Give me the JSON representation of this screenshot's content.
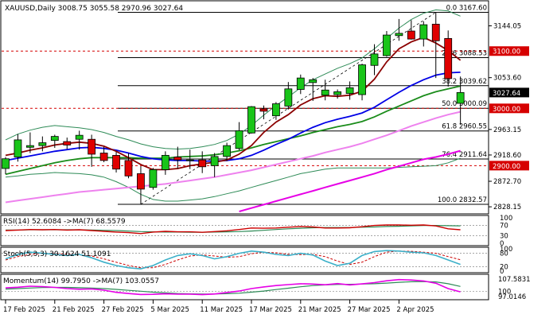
{
  "chart_data": {
    "type": "candlestick",
    "symbol_line": "XAUUSD,Daily  3008.75 3055.58 2970.96 3027.64",
    "price_axis": {
      "ylim": [
        2820,
        3185
      ],
      "ticks": [
        "3144.05",
        "3053.60",
        "2963.15",
        "2918.60",
        "2872.70",
        "2828.15"
      ],
      "tick_values": [
        3144.05,
        3053.6,
        2963.15,
        2918.6,
        2872.7,
        2828.15
      ]
    },
    "dates": [
      "17 Feb 2025",
      "21 Feb 2025",
      "27 Feb 2025",
      "5 Mar 2025",
      "11 Mar 2025",
      "17 Mar 2025",
      "21 Mar 2025",
      "27 Mar 2025",
      "2 Apr 2025"
    ],
    "date_index": [
      0,
      4,
      8,
      12,
      16,
      20,
      24,
      28,
      32
    ],
    "candles": [
      {
        "o": 2895,
        "h": 2915,
        "l": 2885,
        "c": 2912
      },
      {
        "o": 2915,
        "h": 2955,
        "l": 2907,
        "c": 2945
      },
      {
        "o": 2932,
        "h": 2958,
        "l": 2922,
        "c": 2935
      },
      {
        "o": 2935,
        "h": 2951,
        "l": 2925,
        "c": 2940
      },
      {
        "o": 2944,
        "h": 2954,
        "l": 2931,
        "c": 2951
      },
      {
        "o": 2942,
        "h": 2949,
        "l": 2929,
        "c": 2936
      },
      {
        "o": 2946,
        "h": 2961,
        "l": 2928,
        "c": 2953
      },
      {
        "o": 2946,
        "h": 2954,
        "l": 2898,
        "c": 2920
      },
      {
        "o": 2922,
        "h": 2933,
        "l": 2906,
        "c": 2909
      },
      {
        "o": 2918,
        "h": 2924,
        "l": 2888,
        "c": 2894
      },
      {
        "o": 2909,
        "h": 2922,
        "l": 2878,
        "c": 2882
      },
      {
        "o": 2886,
        "h": 2899,
        "l": 2832,
        "c": 2859
      },
      {
        "o": 2862,
        "h": 2896,
        "l": 2858,
        "c": 2893
      },
      {
        "o": 2893,
        "h": 2925,
        "l": 2884,
        "c": 2918
      },
      {
        "o": 2915,
        "h": 2933,
        "l": 2895,
        "c": 2910
      },
      {
        "o": 2909,
        "h": 2928,
        "l": 2894,
        "c": 2910
      },
      {
        "o": 2910,
        "h": 2925,
        "l": 2887,
        "c": 2898
      },
      {
        "o": 2900,
        "h": 2922,
        "l": 2880,
        "c": 2916
      },
      {
        "o": 2916,
        "h": 2940,
        "l": 2908,
        "c": 2935
      },
      {
        "o": 2930,
        "h": 2976,
        "l": 2927,
        "c": 2961
      },
      {
        "o": 2957,
        "h": 3004,
        "l": 2956,
        "c": 3003
      },
      {
        "o": 2999,
        "h": 3005,
        "l": 2981,
        "c": 2995
      },
      {
        "o": 2987,
        "h": 3011,
        "l": 2980,
        "c": 3008
      },
      {
        "o": 3004,
        "h": 3046,
        "l": 2998,
        "c": 3034
      },
      {
        "o": 3033,
        "h": 3059,
        "l": 3025,
        "c": 3053
      },
      {
        "o": 3045,
        "h": 3053,
        "l": 3013,
        "c": 3050
      },
      {
        "o": 3023,
        "h": 3050,
        "l": 3014,
        "c": 3032
      },
      {
        "o": 3024,
        "h": 3033,
        "l": 3017,
        "c": 3029
      },
      {
        "o": 3026,
        "h": 3047,
        "l": 3015,
        "c": 3036
      },
      {
        "o": 3024,
        "h": 3078,
        "l": 3014,
        "c": 3076
      },
      {
        "o": 3075,
        "h": 3112,
        "l": 3058,
        "c": 3095
      },
      {
        "o": 3092,
        "h": 3135,
        "l": 3090,
        "c": 3128
      },
      {
        "o": 3127,
        "h": 3156,
        "l": 3118,
        "c": 3131
      },
      {
        "o": 3135,
        "h": 3154,
        "l": 3120,
        "c": 3121
      },
      {
        "o": 3121,
        "h": 3152,
        "l": 3108,
        "c": 3146
      },
      {
        "o": 3147,
        "h": 3167,
        "l": 3053,
        "c": 3118
      },
      {
        "o": 3122,
        "h": 3136,
        "l": 3038,
        "c": 3052
      },
      {
        "o": 3008.75,
        "h": 3055.58,
        "l": 2970.96,
        "c": 3027.64
      }
    ],
    "overlays": {
      "ma_red": [
        2918,
        2922,
        2927,
        2931,
        2936,
        2939,
        2941,
        2939,
        2934,
        2925,
        2914,
        2902,
        2893,
        2893,
        2895,
        2900,
        2903,
        2906,
        2910,
        2920,
        2935,
        2958,
        2976,
        2989,
        3006,
        3017,
        3022,
        3021,
        3023,
        3030,
        3051,
        3081,
        3104,
        3116,
        3124,
        3114,
        3101,
        3084
      ],
      "ma_blue": [
        2909,
        2913,
        2917,
        2921,
        2925,
        2928,
        2931,
        2932,
        2930,
        2927,
        2922,
        2916,
        2912,
        2910,
        2909,
        2909,
        2908,
        2908,
        2909,
        2912,
        2918,
        2927,
        2937,
        2946,
        2957,
        2967,
        2975,
        2981,
        2986,
        2992,
        3002,
        3015,
        3028,
        3040,
        3050,
        3058,
        3062,
        3063
      ],
      "ma_green": [
        2885,
        2890,
        2895,
        2900,
        2905,
        2909,
        2912,
        2914,
        2914,
        2914,
        2914,
        2913,
        2913,
        2913,
        2915,
        2916,
        2917,
        2919,
        2922,
        2926,
        2931,
        2937,
        2942,
        2947,
        2952,
        2958,
        2963,
        2968,
        2972,
        2977,
        2985,
        2995,
        3004,
        3013,
        3022,
        3029,
        3034,
        3039
      ],
      "ma_pink": [
        2836,
        2839,
        2842,
        2845,
        2848,
        2851,
        2854,
        2856,
        2858,
        2860,
        2862,
        2864,
        2866,
        2868,
        2871,
        2874,
        2877,
        2880,
        2884,
        2888,
        2892,
        2897,
        2902,
        2907,
        2912,
        2917,
        2923,
        2928,
        2933,
        2939,
        2946,
        2953,
        2961,
        2969,
        2976,
        2983,
        2989,
        2994
      ],
      "ma_magenta_start_index": 19,
      "ma_magenta": [
        2820,
        2826,
        2832,
        2838,
        2844,
        2850,
        2856,
        2862,
        2868,
        2874,
        2880,
        2886,
        2893,
        2899,
        2905,
        2911,
        2915,
        2920,
        2926
      ],
      "bb_upper": [
        2945,
        2955,
        2962,
        2967,
        2970,
        2968,
        2966,
        2963,
        2958,
        2951,
        2945,
        2938,
        2933,
        2930,
        2929,
        2930,
        2933,
        2937,
        2944,
        2955,
        2970,
        2988,
        3005,
        3020,
        3036,
        3050,
        3060,
        3070,
        3078,
        3088,
        3104,
        3122,
        3140,
        3155,
        3166,
        3172,
        3170,
        3161
      ],
      "bb_lower": [
        2880,
        2882,
        2885,
        2886,
        2888,
        2887,
        2886,
        2884,
        2880,
        2872,
        2862,
        2850,
        2841,
        2838,
        2838,
        2840,
        2842,
        2846,
        2851,
        2856,
        2862,
        2868,
        2874,
        2880,
        2886,
        2890,
        2894,
        2896,
        2896,
        2896,
        2896,
        2896,
        2897,
        2898,
        2899,
        2900,
        2905,
        2913
      ],
      "fib_line": {
        "from_index": 11,
        "from_price": 2832.57,
        "to_index": 35,
        "to_price": 3167.6
      }
    },
    "horizontal_levels": [
      {
        "label": "0.0 3167.60",
        "value": 3167.6,
        "style": "fib"
      },
      {
        "label": "23.6 3088.53",
        "value": 3088.53,
        "style": "fib"
      },
      {
        "label": "38.2 3039.62",
        "value": 3039.62,
        "style": "fib"
      },
      {
        "label": "50.0 3000.09",
        "value": 3000.09,
        "style": "fib"
      },
      {
        "label": "61.8 2960.55",
        "value": 2960.55,
        "style": "fib"
      },
      {
        "label": "76.4 2911.64",
        "value": 2911.64,
        "style": "fib"
      },
      {
        "label": "100.0 2832.57",
        "value": 2832.57,
        "style": "fib"
      },
      {
        "label": "",
        "value": 3100,
        "style": "red-dashed"
      },
      {
        "label": "",
        "value": 3000,
        "style": "red-dashed"
      },
      {
        "label": "",
        "value": 2900,
        "style": "red-dashed"
      }
    ],
    "price_tags": [
      {
        "text": "3100.00",
        "value": 3100,
        "bg": "#d60000",
        "fg": "#ffffff"
      },
      {
        "text": "3027.64",
        "value": 3027.64,
        "bg": "#000000",
        "fg": "#ffffff"
      },
      {
        "text": "3000.00",
        "value": 3000,
        "bg": "#d60000",
        "fg": "#ffffff"
      },
      {
        "text": "2900.00",
        "value": 2900,
        "bg": "#d60000",
        "fg": "#ffffff"
      }
    ],
    "rsi_panel": {
      "label": "RSI(14) 52.6084  ->MA(7) 68.5579",
      "ylim": [
        0,
        100
      ],
      "ticks": [
        "100",
        "70",
        "30",
        "0"
      ],
      "tick_values": [
        100,
        70,
        30,
        0
      ],
      "rsi": [
        50,
        52,
        54,
        53,
        54,
        52,
        53,
        50,
        47,
        44,
        42,
        38,
        44,
        47,
        45,
        45,
        43,
        46,
        49,
        54,
        60,
        59,
        60,
        63,
        66,
        64,
        60,
        60,
        61,
        65,
        70,
        72,
        72,
        71,
        72,
        68,
        57,
        53
      ],
      "ma": [
        52,
        52,
        53,
        53,
        53,
        53,
        53,
        52,
        51,
        50,
        48,
        46,
        45,
        44,
        44,
        43,
        43,
        44,
        45,
        46,
        48,
        51,
        54,
        57,
        59,
        61,
        62,
        62,
        62,
        63,
        64,
        66,
        67,
        68,
        70,
        70,
        69,
        68.56
      ]
    },
    "stoch_panel": {
      "label": "Stoch(5,3,3) 30.1624 51.1091",
      "ylim": [
        0,
        100
      ],
      "ticks": [
        "100",
        "80",
        "20",
        "0"
      ],
      "tick_values": [
        100,
        80,
        20,
        0
      ],
      "k": [
        55,
        75,
        85,
        80,
        75,
        70,
        75,
        60,
        40,
        25,
        15,
        10,
        25,
        50,
        70,
        78,
        70,
        55,
        65,
        80,
        90,
        85,
        75,
        70,
        80,
        72,
        45,
        25,
        35,
        70,
        88,
        92,
        90,
        85,
        82,
        70,
        50,
        30
      ],
      "d": [
        50,
        65,
        75,
        80,
        78,
        75,
        73,
        68,
        55,
        40,
        25,
        15,
        15,
        30,
        50,
        68,
        73,
        68,
        62,
        65,
        78,
        85,
        82,
        75,
        74,
        75,
        65,
        45,
        30,
        40,
        65,
        85,
        90,
        89,
        85,
        80,
        65,
        51
      ]
    },
    "momentum_panel": {
      "label": "Momentum(14) 99.7950  ->MA(7) 103.0557",
      "ylim": [
        96,
        109
      ],
      "ticks": [
        "107.5831",
        "100",
        "97.0146"
      ],
      "tick_values": [
        107.5831,
        100,
        97.0146
      ],
      "momentum": [
        102.2,
        102.6,
        103.2,
        103.0,
        102.5,
        101.8,
        101.4,
        101.6,
        100.8,
        99.5,
        98.8,
        98.2,
        98.3,
        98.6,
        98.4,
        98.4,
        98.1,
        98.5,
        99.4,
        100.3,
        101.8,
        102.8,
        103.6,
        104.2,
        104.7,
        104.5,
        104.1,
        104.8,
        104.0,
        104.6,
        105.4,
        106.5,
        107.2,
        107.0,
        106.4,
        105.0,
        101.8,
        99.8
      ],
      "ma": [
        101.5,
        101.8,
        102.1,
        102.4,
        102.5,
        102.5,
        102.3,
        102.1,
        101.8,
        101.3,
        100.7,
        100.2,
        99.6,
        99.2,
        98.8,
        98.6,
        98.5,
        98.5,
        98.7,
        99.0,
        99.6,
        100.3,
        101.2,
        102.0,
        102.9,
        103.6,
        104.0,
        104.3,
        104.4,
        104.5,
        104.7,
        105.1,
        105.6,
        105.9,
        106.0,
        105.8,
        104.7,
        103.06
      ]
    },
    "colors": {
      "bull_candle": "#19c519",
      "bear_candle": "#e00000",
      "ma_red": "#8b0000",
      "ma_blue": "#0000e6",
      "ma_green": "#1a8c1a",
      "ma_pink": "#ee82ee",
      "ma_magenta": "#e600e6",
      "bollinger": "#2e8b57",
      "fib_line": "#000000",
      "red_level": "#d60000",
      "rsi_line": "#cc0000",
      "rsi_ma": "#2e8b57",
      "stoch_k": "#3cb0c9",
      "stoch_d": "#cc0000",
      "momentum_line": "#e600e6",
      "momentum_ma": "#2e8b57"
    }
  }
}
